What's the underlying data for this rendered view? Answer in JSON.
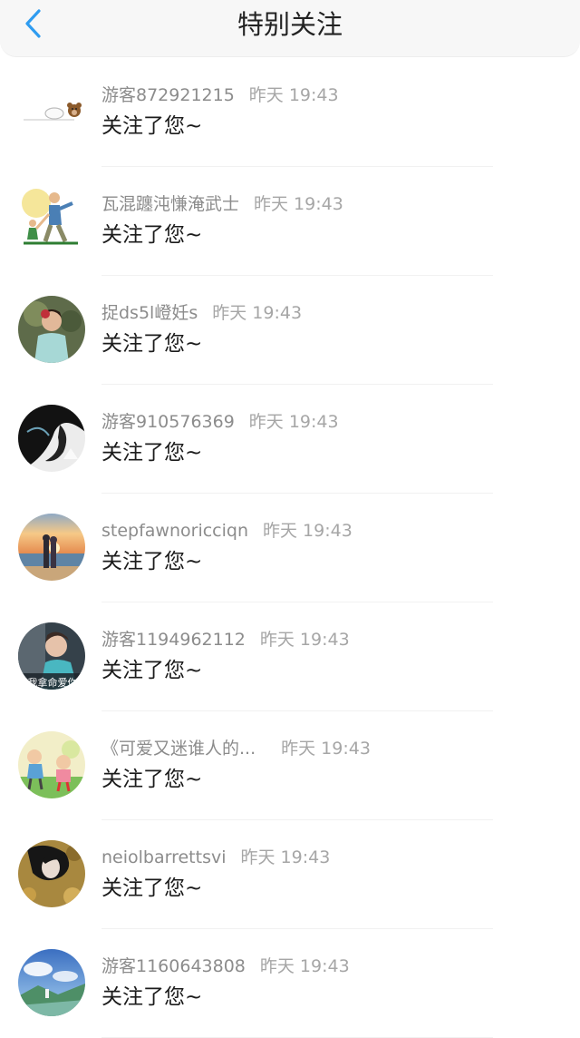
{
  "header": {
    "title": "特别关注",
    "back_icon": "chevron-left-icon",
    "accent_color": "#2f9cf0"
  },
  "notifications": [
    {
      "user": "游客872921215",
      "time": "昨天 19:43",
      "message": "关注了您~",
      "avatar": "bear-banner-avatar"
    },
    {
      "user": "瓦混躔沌慊淹武士",
      "time": "昨天 19:43",
      "message": "关注了您~",
      "avatar": "parent-child-illustration-avatar"
    },
    {
      "user": "捉ds5l嶝妊s",
      "time": "昨天 19:43",
      "message": "关注了您~",
      "avatar": "girl-portrait-avatar"
    },
    {
      "user": "游客910576369",
      "time": "昨天 19:43",
      "message": "关注了您~",
      "avatar": "ink-art-avatar"
    },
    {
      "user": "stepfawnoricciqn",
      "time": "昨天 19:43",
      "message": "关注了您~",
      "avatar": "beach-sunset-couple-avatar"
    },
    {
      "user": "游客1194962112",
      "time": "昨天 19:43",
      "message": "关注了您~",
      "avatar": "person-text-avatar",
      "avatar_text": "我拿命爱你"
    },
    {
      "user": "《可爱又迷谁人的...",
      "time": "昨天 19:43",
      "message": "关注了您~",
      "avatar": "cartoon-kids-avatar"
    },
    {
      "user": "neiolbarrettsvi",
      "time": "昨天 19:43",
      "message": "关注了您~",
      "avatar": "woman-leaves-avatar"
    },
    {
      "user": "游客1160643808",
      "time": "昨天 19:43",
      "message": "关注了您~",
      "avatar": "landscape-avatar"
    }
  ]
}
